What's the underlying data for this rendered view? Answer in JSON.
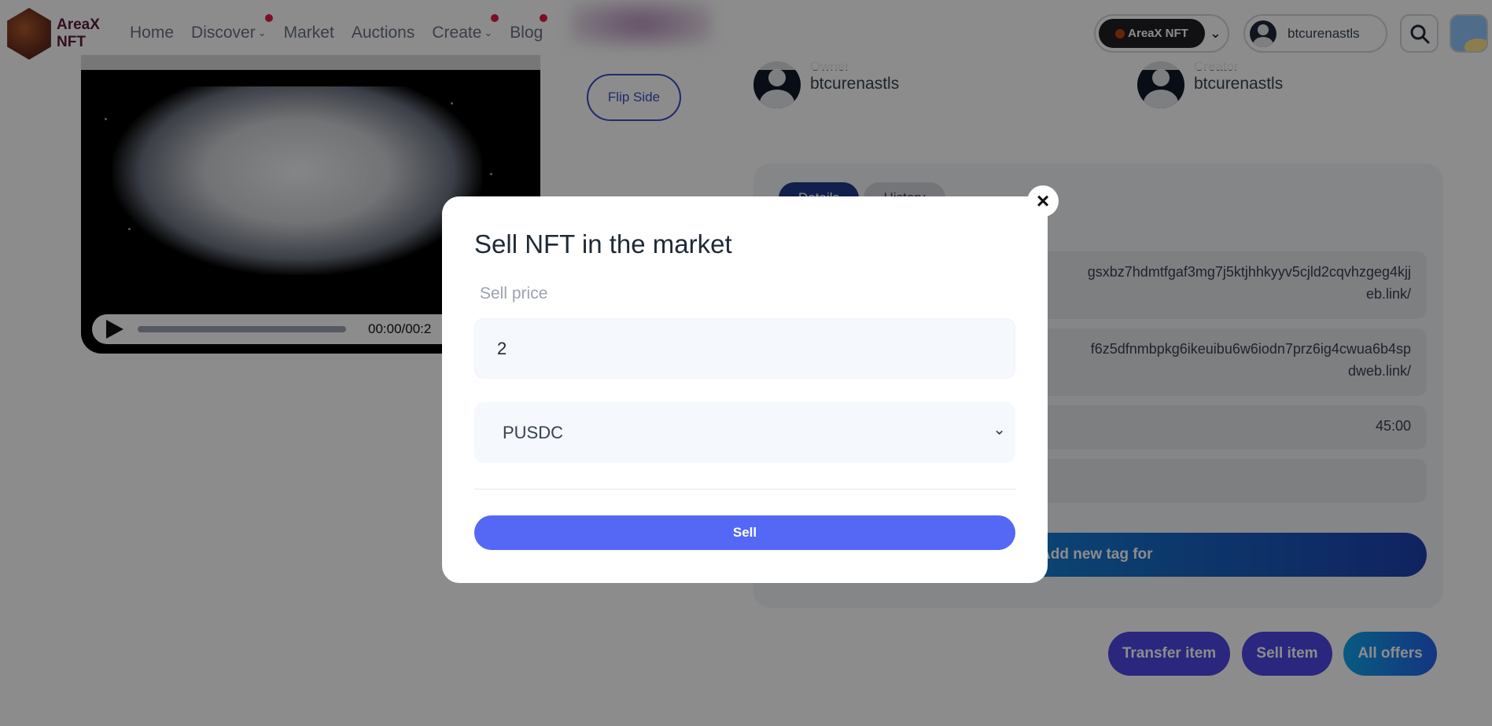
{
  "brand": {
    "logo_line1": "AreaX",
    "logo_line2": "NFT"
  },
  "nav": {
    "items": [
      {
        "label": "Home"
      },
      {
        "label": "Discover"
      },
      {
        "label": "Market"
      },
      {
        "label": "Auctions"
      },
      {
        "label": "Create"
      },
      {
        "label": "Blog"
      }
    ]
  },
  "header": {
    "network_label": "AreaX NFT",
    "username": "btcurenastls"
  },
  "media": {
    "time": "00:00/00:2"
  },
  "actions": {
    "flip_side": "Flip Side"
  },
  "people": {
    "owner_role": "Owner",
    "owner_name": "btcurenastls",
    "creator_role": "Creator",
    "creator_name": "btcurenastls"
  },
  "details": {
    "tabs": [
      "Details",
      "History"
    ],
    "rows": [
      "gsxbz7hdmtfgaf3mg7j5ktjhhkyyv5cjld2cqvhzgeg4kjj\neb.link/",
      "f6z5dfnmbpkg6ikeuibu6w6iodn7prz6ig4cwua6b4sp\ndweb.link/",
      "45:00",
      ""
    ],
    "add_tag": "Add new tag for"
  },
  "bottom_buttons": {
    "transfer": "Transfer item",
    "sell": "Sell item",
    "offers": "All offers"
  },
  "modal": {
    "title": "Sell NFT in the market",
    "price_label": "Sell price",
    "price_value": "2",
    "currency": "PUSDC",
    "submit": "Sell",
    "close_glyph": "×"
  },
  "colors": {
    "accent": "#5468f5",
    "nav_dot": "#e11d48",
    "tab_active": "#1e3a8a"
  }
}
